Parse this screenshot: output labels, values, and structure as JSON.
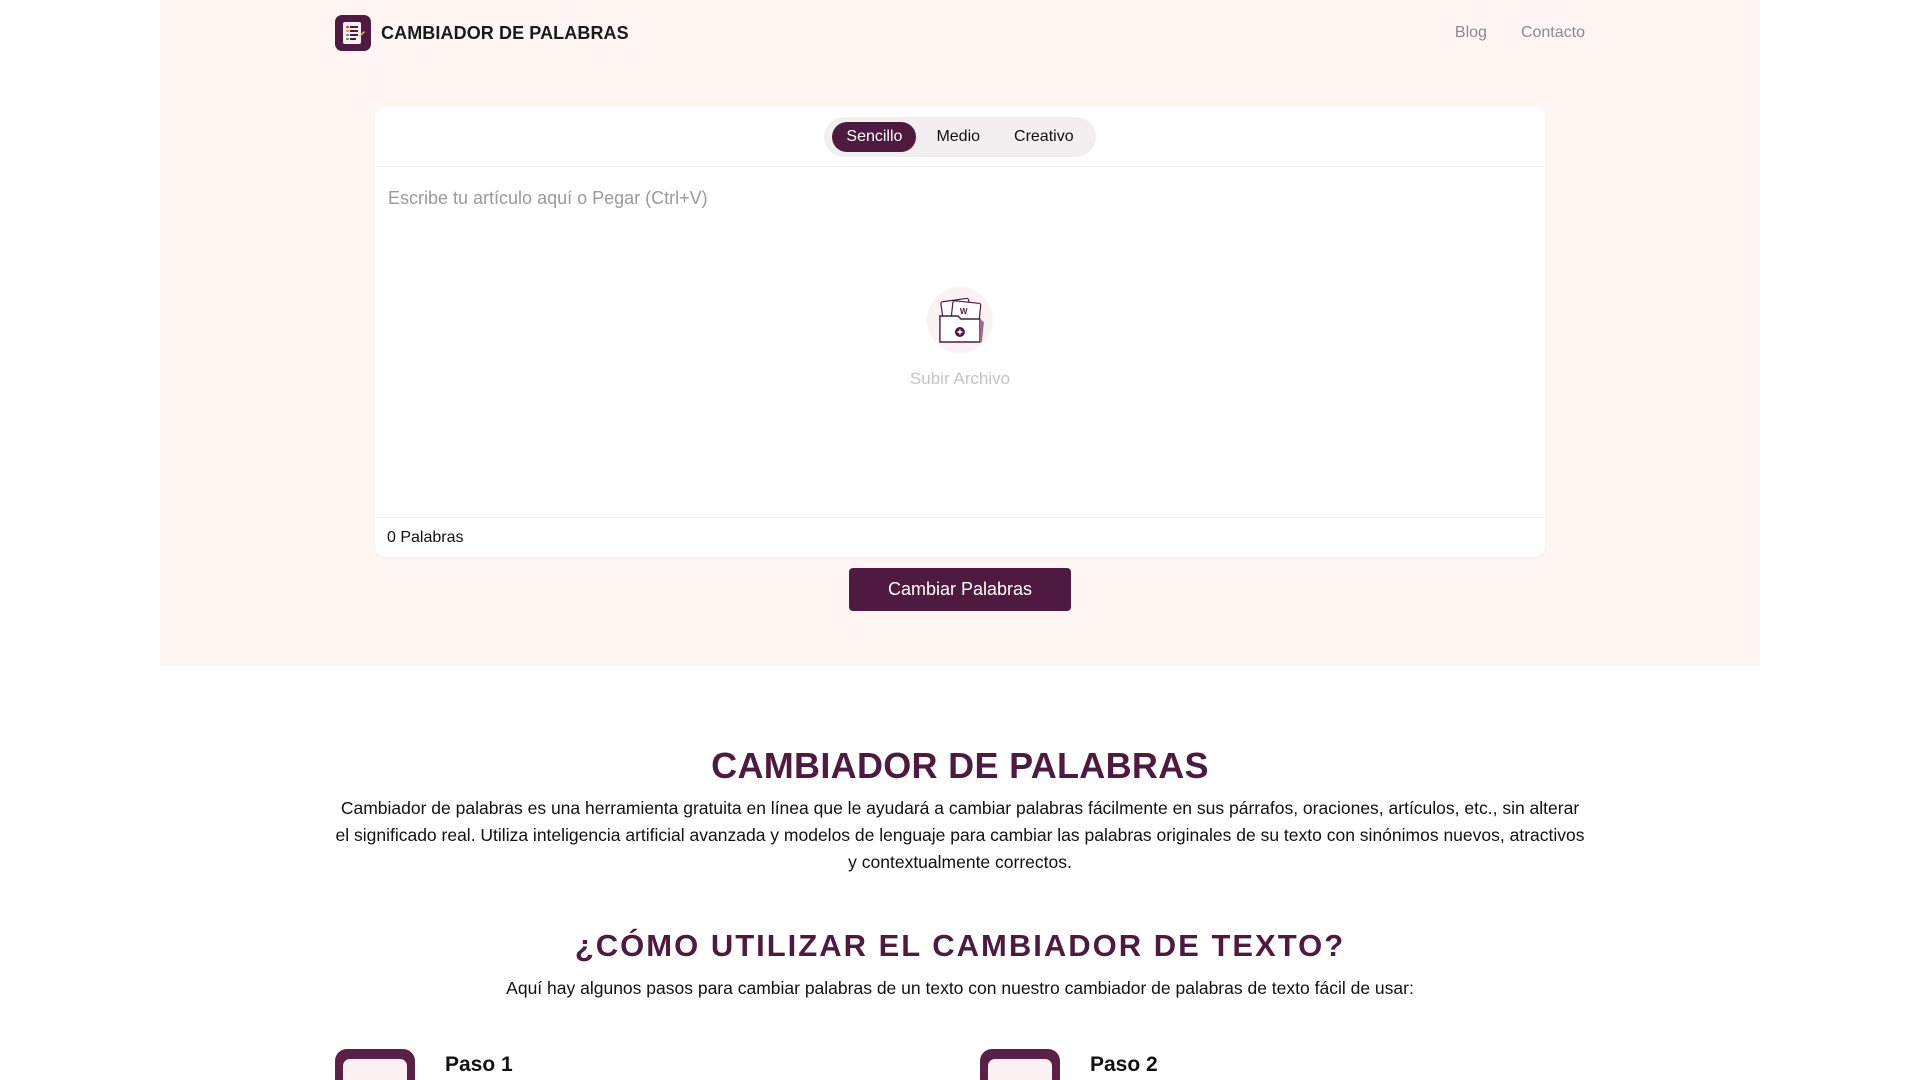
{
  "header": {
    "brand": "CAMBIADOR DE PALABRAS",
    "nav": [
      "Blog",
      "Contacto"
    ]
  },
  "editor": {
    "modes": [
      "Sencillo",
      "Medio",
      "Creativo"
    ],
    "active_mode": "Sencillo",
    "placeholder": "Escribe tu artículo aquí o Pegar (Ctrl+V)",
    "value": "",
    "upload_label": "Subir Archivo",
    "word_count": "0 Palabras"
  },
  "cta_label": "Cambiar Palabras",
  "content": {
    "title": "CAMBIADOR DE PALABRAS",
    "intro": "Cambiador de palabras es una herramienta gratuita en línea que le ayudará a cambiar palabras fácilmente en sus párrafos, oraciones, artículos, etc., sin alterar el significado real. Utiliza inteligencia artificial avanzada y modelos de lenguaje para cambiar las palabras originales de su texto con sinónimos nuevos, atractivos y contextualmente correctos.",
    "how_title": "¿CÓMO UTILIZAR EL CAMBIADOR DE TEXTO?",
    "how_sub": "Aquí hay algunos pasos para cambiar palabras de un texto con nuestro cambiador de palabras de texto fácil de usar:"
  },
  "steps": [
    {
      "title": "Paso 1",
      "icon": "document-icon"
    },
    {
      "title": "Paso 2",
      "icon": "document-icon"
    }
  ],
  "colors": {
    "brand": "#4f1a3f",
    "hero_bg": "#fff6f4"
  }
}
